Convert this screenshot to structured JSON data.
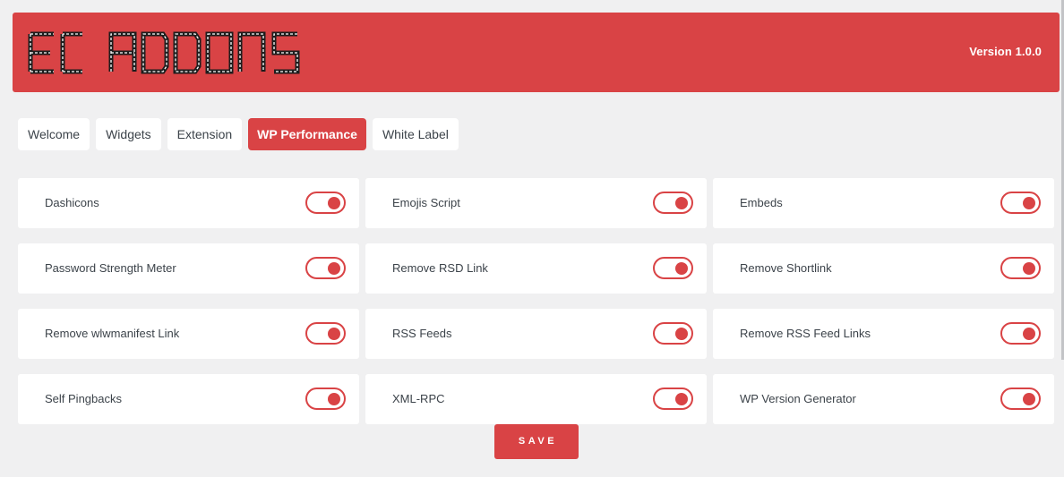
{
  "header": {
    "logo_text": "EC ADDONS",
    "version": "Version 1.0.0"
  },
  "tabs": [
    {
      "label": "Welcome",
      "active": false
    },
    {
      "label": "Widgets",
      "active": false
    },
    {
      "label": "Extension",
      "active": false
    },
    {
      "label": "WP Performance",
      "active": true
    },
    {
      "label": "White Label",
      "active": false
    }
  ],
  "settings": [
    {
      "label": "Dashicons",
      "enabled": true
    },
    {
      "label": "Emojis Script",
      "enabled": true
    },
    {
      "label": "Embeds",
      "enabled": true
    },
    {
      "label": "Password Strength Meter",
      "enabled": true
    },
    {
      "label": "Remove RSD Link",
      "enabled": true
    },
    {
      "label": "Remove Shortlink",
      "enabled": true
    },
    {
      "label": "Remove wlwmanifest Link",
      "enabled": true
    },
    {
      "label": "RSS Feeds",
      "enabled": true
    },
    {
      "label": "Remove RSS Feed Links",
      "enabled": true
    },
    {
      "label": "Self Pingbacks",
      "enabled": true
    },
    {
      "label": "XML-RPC",
      "enabled": true
    },
    {
      "label": "WP Version Generator",
      "enabled": true
    }
  ],
  "save_label": "SAVE",
  "colors": {
    "accent": "#d94345",
    "background": "#f0f0f1",
    "card": "#ffffff",
    "text": "#3c434a"
  }
}
